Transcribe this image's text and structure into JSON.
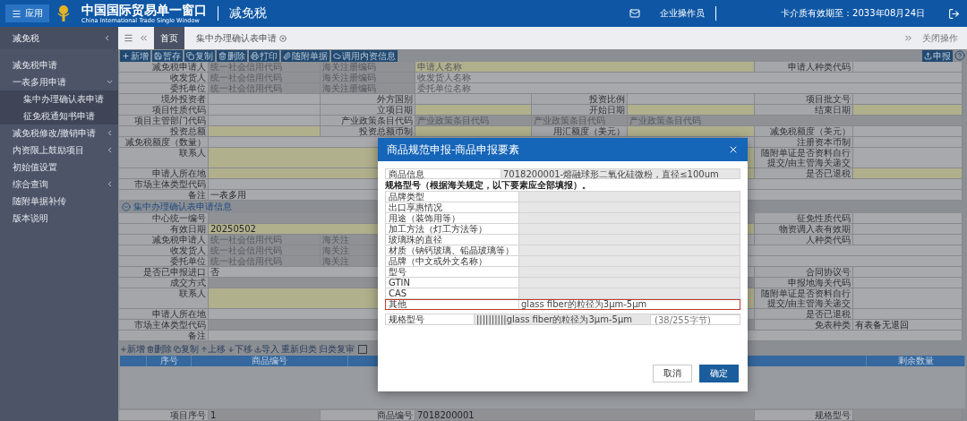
{
  "header": {
    "menu_button": "应用",
    "title": "中国国际贸易单一窗口",
    "subtitle": "China International Trade Single Window",
    "module": "减免税",
    "user": "企业操作员",
    "card_expiry": "卡介质有效期至：2033年08月24日"
  },
  "sidebar": {
    "title": "减免税",
    "items": [
      {
        "label": "减免税申请"
      },
      {
        "label": "一表多用申请",
        "expanded": true,
        "children": [
          {
            "label": "集中办理确认表申请"
          },
          {
            "label": "征免税通知书申请"
          }
        ]
      },
      {
        "label": "减免税修改/撤销申请",
        "expanded": false
      },
      {
        "label": "内资限上鼓励项目",
        "expanded": false
      },
      {
        "label": "初始值设置"
      },
      {
        "label": "综合查询",
        "expanded": false
      },
      {
        "label": "随附单据补传"
      },
      {
        "label": "版本说明"
      }
    ]
  },
  "tabs": [
    {
      "label": "首页",
      "selected": true,
      "closable": false
    },
    {
      "label": "集中办理确认表申请",
      "selected": false,
      "closable": true
    }
  ],
  "tab_bar_action": "关闭操作",
  "toolbar": {
    "buttons": [
      "新增",
      "暂存",
      "复制",
      "删除",
      "打印",
      "随附单据",
      "调用内资信息"
    ],
    "submit": "申报"
  },
  "form_rows": [
    {
      "left": [
        {
          "kind": "label",
          "text": "减免税申请人"
        },
        {
          "kind": "readonly",
          "placeholder": "统一社会信用代码"
        },
        {
          "kind": "readonly",
          "placeholder": "海关注册编码"
        },
        {
          "kind": "required",
          "placeholder": "申请人名称"
        }
      ],
      "right": [
        {
          "kind": "label",
          "text": "申请人种类代码"
        },
        {
          "kind": "input"
        }
      ]
    },
    {
      "left": [
        {
          "kind": "label",
          "text": "收发货人"
        },
        {
          "kind": "readonly",
          "placeholder": "统一社会信用代码"
        },
        {
          "kind": "readonly",
          "placeholder": "海关注册编码"
        },
        {
          "kind": "input",
          "placeholder": "收发货人名称"
        }
      ]
    },
    {
      "left": [
        {
          "kind": "label",
          "text": "委托单位"
        },
        {
          "kind": "readonly",
          "placeholder": "统一社会信用代码"
        },
        {
          "kind": "readonly",
          "placeholder": "海关注册编码"
        },
        {
          "kind": "input",
          "placeholder": "委托单位名称"
        }
      ]
    },
    {
      "left": [
        {
          "kind": "label",
          "text": "境外投资者"
        },
        {
          "kind": "input"
        },
        {
          "kind": "label",
          "text": "外方国别"
        },
        {
          "kind": "input"
        },
        {
          "kind": "label",
          "text": "投资比例"
        },
        {
          "kind": "input"
        },
        {
          "kind": "label",
          "text": "项目批文号"
        },
        {
          "kind": "input"
        }
      ]
    },
    {
      "left": [
        {
          "kind": "label",
          "text": "项目性质代码"
        },
        {
          "kind": "input"
        },
        {
          "kind": "label",
          "text": "立项日期"
        },
        {
          "kind": "required"
        },
        {
          "kind": "label",
          "text": "开始日期"
        },
        {
          "kind": "required"
        },
        {
          "kind": "label",
          "text": "结束日期"
        },
        {
          "kind": "required"
        }
      ]
    },
    {
      "left": [
        {
          "kind": "label",
          "text": "项目主管部门代码"
        },
        {
          "kind": "input"
        },
        {
          "kind": "label",
          "text": "产业政策条目代码"
        },
        {
          "kind": "readonly",
          "placeholder": "产业政策条目代码"
        },
        {
          "kind": "readonly",
          "placeholder": "产业政策条目代码"
        },
        {
          "kind": "readonly",
          "placeholder": "产业政策条目代码"
        }
      ]
    },
    {
      "left": [
        {
          "kind": "label",
          "text": "投资总额"
        },
        {
          "kind": "required"
        },
        {
          "kind": "label",
          "text": "投资总额币制"
        },
        {
          "kind": "required"
        },
        {
          "kind": "label",
          "text": "用汇额度（美元）"
        },
        {
          "kind": "required"
        },
        {
          "kind": "label",
          "text": "减免税额度（美元）"
        },
        {
          "kind": "input"
        }
      ]
    },
    {
      "left": [
        {
          "kind": "label",
          "text": "减免税额度（数量）"
        },
        {
          "kind": "input"
        }
      ],
      "right": [
        {
          "kind": "label",
          "text": "注册资本币制"
        },
        {
          "kind": "input"
        }
      ]
    },
    {
      "left": [
        {
          "kind": "label",
          "text": "联系人"
        },
        {
          "kind": "required"
        }
      ],
      "right": [
        {
          "kind": "label",
          "text": "随附单证是否资料自行提交/由主管海关递交"
        },
        {
          "kind": "input"
        }
      ]
    },
    {
      "left": [
        {
          "kind": "label",
          "text": "申请人所在地"
        },
        {
          "kind": "required"
        }
      ],
      "right": [
        {
          "kind": "label",
          "text": "是否已退税"
        },
        {
          "kind": "required"
        }
      ]
    },
    {
      "left": [
        {
          "kind": "label",
          "text": "市场主体类型代码"
        },
        {
          "kind": "input"
        }
      ]
    },
    {
      "left": [
        {
          "kind": "label",
          "text": "备注"
        },
        {
          "kind": "input",
          "value": "一表多用"
        }
      ]
    }
  ],
  "section_title": "集中办理确认表申请信息",
  "section_rows": [
    {
      "left": [
        {
          "kind": "label",
          "text": "中心统一编号"
        },
        {
          "kind": "readonly"
        }
      ],
      "right": [
        {
          "kind": "label",
          "text": "征免性质代码"
        },
        {
          "kind": "input"
        }
      ]
    },
    {
      "left": [
        {
          "kind": "label",
          "text": "有效日期"
        },
        {
          "kind": "required",
          "value": "20250502"
        }
      ],
      "right": [
        {
          "kind": "label",
          "text": "物资调入表有效期"
        },
        {
          "kind": "input"
        }
      ]
    },
    {
      "left": [
        {
          "kind": "label",
          "text": "减免税申请人"
        },
        {
          "kind": "readonly",
          "placeholder": "统一社会信用代码"
        },
        {
          "kind": "readonly",
          "placeholder": "海关注"
        },
        {
          "kind": "input"
        }
      ],
      "right": [
        {
          "kind": "label",
          "text": "人种类代码"
        },
        {
          "kind": "input"
        }
      ]
    },
    {
      "left": [
        {
          "kind": "label",
          "text": "收发货人"
        },
        {
          "kind": "readonly",
          "placeholder": "统一社会信用代码"
        },
        {
          "kind": "readonly",
          "placeholder": "海关注"
        },
        {
          "kind": "input"
        }
      ]
    },
    {
      "left": [
        {
          "kind": "label",
          "text": "委托单位"
        },
        {
          "kind": "readonly",
          "placeholder": "统一社会信用代码"
        },
        {
          "kind": "readonly",
          "placeholder": "海关注"
        },
        {
          "kind": "input"
        }
      ]
    },
    {
      "left": [
        {
          "kind": "label",
          "text": "是否已申报进口"
        },
        {
          "kind": "input",
          "value": "否"
        }
      ],
      "right": [
        {
          "kind": "label",
          "text": "合同协议号"
        },
        {
          "kind": "input"
        }
      ]
    },
    {
      "left": [
        {
          "kind": "label",
          "text": "成交方式"
        },
        {
          "kind": "readonly"
        }
      ],
      "right": [
        {
          "kind": "label",
          "text": "申报地海关代码"
        },
        {
          "kind": "input"
        }
      ]
    },
    {
      "left": [
        {
          "kind": "label",
          "text": "联系人"
        },
        {
          "kind": "required"
        }
      ],
      "right": [
        {
          "kind": "label",
          "text": "随附单证是否资料自行提交/由主管海关递交"
        },
        {
          "kind": "input"
        }
      ]
    },
    {
      "left": [
        {
          "kind": "label",
          "text": "申请人所在地"
        },
        {
          "kind": "input"
        }
      ],
      "right": [
        {
          "kind": "label",
          "text": "是否已退税"
        },
        {
          "kind": "input"
        }
      ]
    },
    {
      "left": [
        {
          "kind": "label",
          "text": "市场主体类型代码"
        },
        {
          "kind": "readonly"
        }
      ],
      "right": [
        {
          "kind": "label",
          "text": "免表种类"
        },
        {
          "kind": "input",
          "value": "有表备无退回"
        }
      ]
    },
    {
      "left": [
        {
          "kind": "label",
          "text": "备注"
        },
        {
          "kind": "input"
        }
      ]
    }
  ],
  "goods_toolbar": {
    "buttons": [
      "新增",
      "删除",
      "复制",
      "上移",
      "下移",
      "导入",
      "重新归类",
      "归类复审"
    ],
    "checked": false
  },
  "goods_table": {
    "columns": [
      "序号",
      "商品编号",
      "剩余数量"
    ]
  },
  "detail_row": {
    "left": [
      {
        "kind": "label",
        "text": "项目序号"
      },
      {
        "kind": "readonly",
        "value": "1"
      },
      {
        "kind": "label",
        "text": "商品编号"
      },
      {
        "kind": "readonly",
        "value": "7018200001"
      }
    ],
    "right": [
      {
        "kind": "label",
        "text": "规格型号"
      },
      {
        "kind": "readonly"
      }
    ]
  },
  "dialog": {
    "title": "商品规范申报-商品申报要素",
    "goods_label": "商品信息",
    "goods_value": "7018200001-熔融球形二氧化硅微粉，直径≤100um",
    "note": "规格型号（根据海关规定，以下要素应全部填报）。",
    "elements": [
      {
        "label": "品牌类型",
        "editable": false,
        "highlighted": false
      },
      {
        "label": "出口享惠情况",
        "editable": false,
        "highlighted": false
      },
      {
        "label": "用途（装饰用等）",
        "editable": false,
        "highlighted": false
      },
      {
        "label": "加工方法（灯工方法等）",
        "editable": false,
        "highlighted": false
      },
      {
        "label": "玻璃珠的直径",
        "editable": false,
        "highlighted": false
      },
      {
        "label": "材质（钠钙玻璃、铅晶玻璃等）",
        "editable": false,
        "highlighted": false
      },
      {
        "label": "品牌（中文或外文名称）",
        "editable": false,
        "highlighted": false
      },
      {
        "label": "型号",
        "editable": false,
        "highlighted": false
      },
      {
        "label": "GTIN",
        "editable": false,
        "highlighted": false
      },
      {
        "label": "CAS",
        "editable": false,
        "highlighted": false
      },
      {
        "label": "其他",
        "value": "glass fiber的粒径为3μm-5μm",
        "editable": true,
        "highlighted": true
      }
    ],
    "spec_label": "规格型号",
    "spec_value": "||||||||||glass fiber的粒径为3μm-5μm",
    "spec_count": "(38/255字节)",
    "buttons": [
      {
        "label": "取消",
        "primary": false
      },
      {
        "label": "确定",
        "primary": true
      }
    ]
  }
}
